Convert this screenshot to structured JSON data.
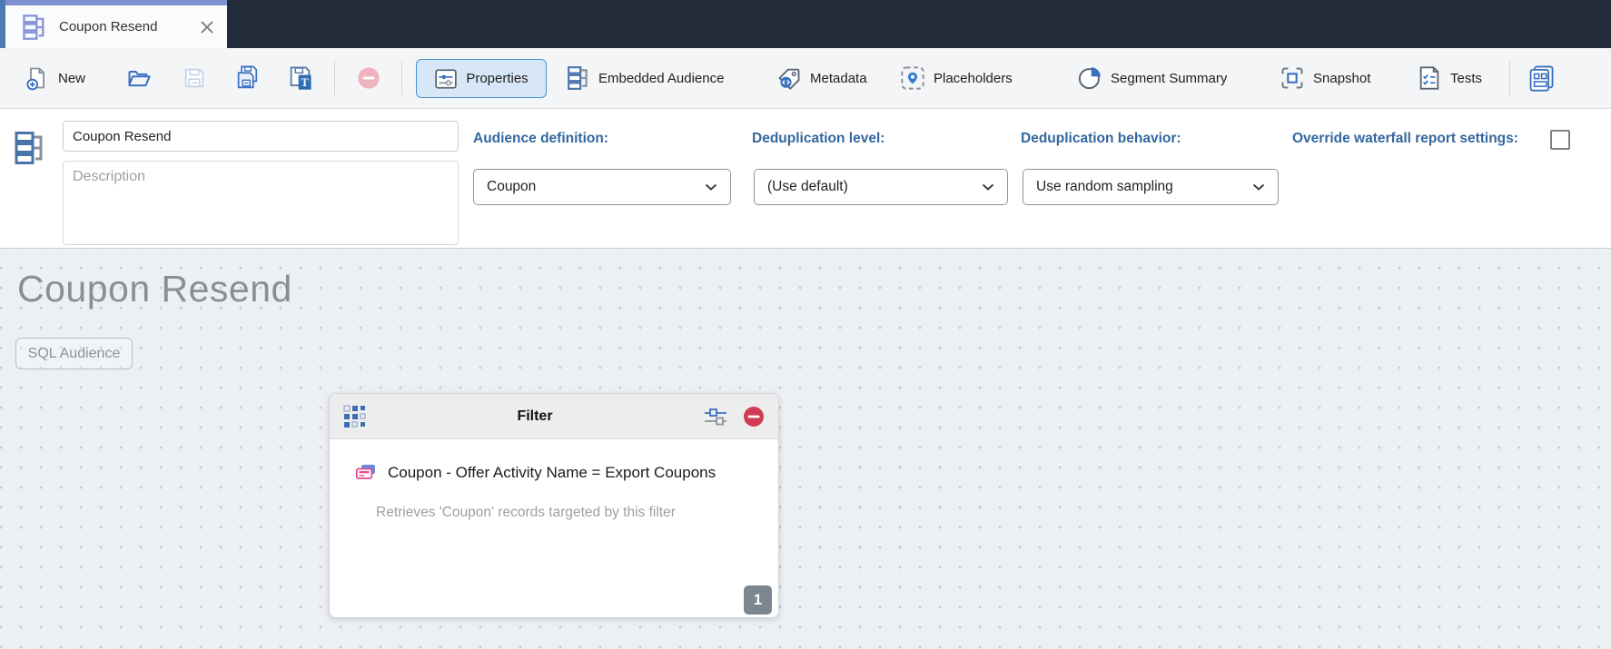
{
  "tab": {
    "title": "Coupon Resend"
  },
  "toolbar": {
    "new_label": "New",
    "properties_label": "Properties",
    "embedded_audience_label": "Embedded Audience",
    "metadata_label": "Metadata",
    "placeholders_label": "Placeholders",
    "segment_summary_label": "Segment Summary",
    "snapshot_label": "Snapshot",
    "tests_label": "Tests",
    "save_template_letter": "T"
  },
  "properties_panel": {
    "name_value": "Coupon Resend",
    "description_placeholder": "Description",
    "audience_definition": {
      "label": "Audience definition:",
      "value": "Coupon"
    },
    "dedup_level": {
      "label": "Deduplication level:",
      "value": "(Use default)"
    },
    "dedup_behavior": {
      "label": "Deduplication behavior:",
      "value": "Use random sampling"
    },
    "override": {
      "label": "Override waterfall report settings:",
      "checked": false
    }
  },
  "canvas": {
    "title": "Coupon Resend",
    "sql_audience_label": "SQL Audience",
    "filter_node": {
      "title": "Filter",
      "rule_text": "Coupon - Offer Activity Name = Export Coupons",
      "description": "Retrieves 'Coupon' records targeted by this filter",
      "count_badge": "1"
    }
  },
  "icons": [
    "audience-hierarchy-icon",
    "close-icon",
    "new-document-icon",
    "open-folder-icon",
    "save-icon",
    "save-copy-icon",
    "save-template-icon",
    "remove-icon-disabled",
    "properties-sliders-icon",
    "embedded-audience-icon",
    "metadata-tag-icon",
    "placeholders-pin-icon",
    "segment-summary-pie-icon",
    "snapshot-icon",
    "tests-checklist-icon",
    "panels-icon",
    "drag-grid-icon",
    "filter-settings-icon",
    "remove-node-icon",
    "coupon-cards-icon",
    "chevron-down-icon"
  ],
  "colors": {
    "accent_label_blue": "#33679E",
    "icon_blue": "#3A6FC0",
    "selected_button_bg": "#D8E7F7",
    "selected_button_border": "#4A90D2",
    "tab_stripe": "#7E92D3",
    "titlebar_navy": "#212B3A",
    "left_strip_blue": "#4D7AB2",
    "remove_red": "#D23B55",
    "coupon_pink": "#E8448B",
    "canvas_bg": "#EDF0F3",
    "badge_gray": "#7B8690"
  }
}
